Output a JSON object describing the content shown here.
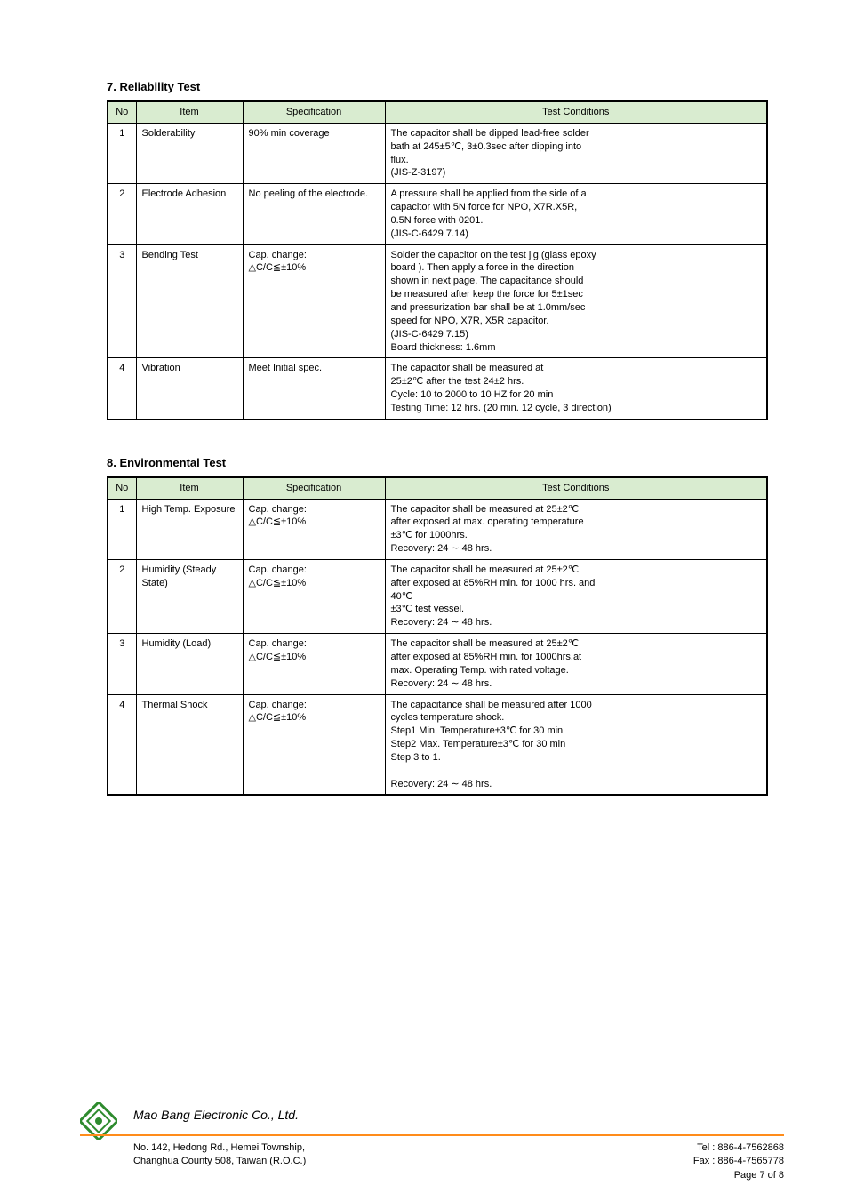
{
  "section1": {
    "title": "7. Reliability Test"
  },
  "table1": {
    "headers": {
      "no": "No",
      "item": "Item",
      "spec": "Specification",
      "cond": "Test Conditions"
    },
    "rows": [
      {
        "no": "1",
        "item": "Solderability",
        "spec": "90% min coverage",
        "cond": "The capacitor shall be dipped lead-free solder\nbath at 245±5℃, 3±0.3sec after dipping into\nflux.\n(JIS-Z-3197)"
      },
      {
        "no": "2",
        "item": "Electrode Adhesion",
        "spec": "No peeling of the electrode.",
        "cond": "A pressure shall be applied from the side of a\ncapacitor with 5N force for NPO, X7R.X5R,\n0.5N force with 0201.\n(JIS-C-6429 7.14)"
      },
      {
        "no": "3",
        "item": "Bending Test",
        "spec": "Cap. change:\n△C/C≦±10%",
        "cond": "Solder the capacitor on the test jig (glass epoxy\nboard ). Then apply a force in the direction\nshown in next page. The capacitance should\nbe measured after keep the force for 5±1sec\nand pressurization bar shall be at 1.0mm/sec\nspeed for NPO, X7R, X5R capacitor.\n(JIS-C-6429 7.15)\nBoard thickness: 1.6mm"
      },
      {
        "no": "4",
        "item": "Vibration",
        "spec": "Meet Initial spec.",
        "cond": "The capacitor shall be measured at\n25±2℃ after the test 24±2 hrs.\nCycle: 10 to 2000 to 10 HZ for 20 min\nTesting Time: 12 hrs. (20 min. 12 cycle, 3 direction)"
      }
    ]
  },
  "section2": {
    "title": "8. Environmental Test"
  },
  "table2": {
    "headers": {
      "no": "No",
      "item": "Item",
      "spec": "Specification",
      "cond": "Test Conditions"
    },
    "rows": [
      {
        "no": "1",
        "item": "High Temp. Exposure",
        "spec": "Cap. change:\n△C/C≦±10%\n",
        "cond": "The capacitor shall be measured at 25±2℃\nafter exposed at max. operating temperature\n±3℃ for 1000hrs.\nRecovery: 24 ∼ 48 hrs."
      },
      {
        "no": "2",
        "item": "Humidity (Steady State)",
        "spec": "Cap. change:\n△C/C≦±10%",
        "cond": "The capacitor shall be measured at 25±2℃\nafter exposed at 85%RH min. for 1000 hrs. and\n40℃\n±3℃ test vessel.\nRecovery: 24 ∼ 48 hrs."
      },
      {
        "no": "3",
        "item": "Humidity (Load)",
        "spec": "Cap. change:\n△C/C≦±10%",
        "cond": "The capacitor shall be measured at 25±2℃\nafter exposed at 85%RH min. for 1000hrs.at\nmax. Operating Temp. with rated voltage.\nRecovery: 24 ∼ 48 hrs."
      },
      {
        "no": "4",
        "item": "Thermal Shock",
        "spec": "Cap. change:\n△C/C≦±10%",
        "cond": "The capacitance shall be measured after 1000\ncycles temperature shock.\nStep1 Min. Temperature±3℃ for 30 min\nStep2 Max. Temperature±3℃ for 30 min\nStep 3 to 1.\n\nRecovery: 24 ∼ 48 hrs."
      }
    ]
  },
  "footer": {
    "company": "Mao Bang Electronic Co., Ltd.",
    "addr1": "No. 142, Hedong Rd., Hemei Township,",
    "addr2": "Changhua County 508, Taiwan (R.O.C.)",
    "tel": "Tel : 886-4-7562868",
    "fax": "Fax : 886-4-7565778",
    "page": "Page 7 of 8"
  }
}
